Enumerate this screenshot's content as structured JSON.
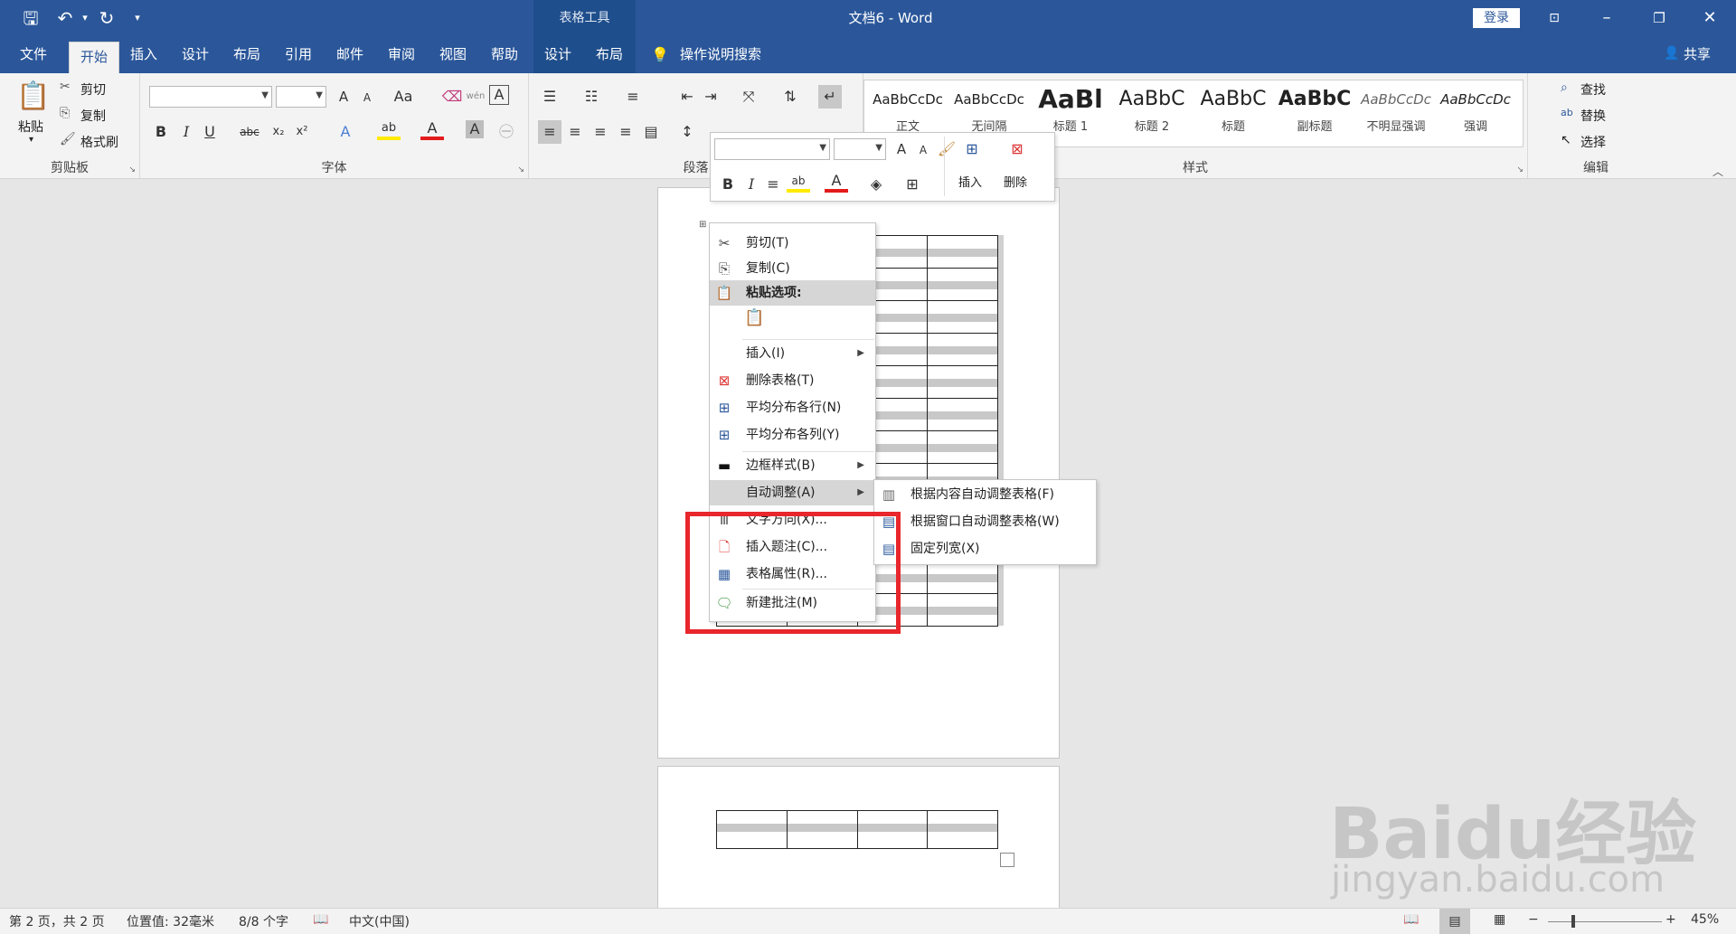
{
  "window": {
    "title": "文档6  -  Word",
    "context_title": "表格工具",
    "login": "登录",
    "share": "共享"
  },
  "tabs": [
    {
      "label": "文件"
    },
    {
      "label": "开始"
    },
    {
      "label": "插入"
    },
    {
      "label": "设计"
    },
    {
      "label": "布局"
    },
    {
      "label": "引用"
    },
    {
      "label": "邮件"
    },
    {
      "label": "审阅"
    },
    {
      "label": "视图"
    },
    {
      "label": "帮助"
    },
    {
      "label": "设计"
    },
    {
      "label": "布局"
    }
  ],
  "tell_me": "操作说明搜索",
  "ribbon": {
    "clipboard": {
      "label": "剪贴板",
      "paste": "粘贴",
      "cut": "剪切",
      "copy": "复制",
      "format_painter": "格式刷"
    },
    "font": {
      "label": "字体",
      "bold": "B",
      "italic": "I",
      "underline": "U",
      "strike": "abc",
      "sub": "x₂",
      "sup": "x²",
      "grow": "A",
      "shrink": "A",
      "case": "Aa",
      "font_color": "A",
      "char_shade": "A",
      "phonetic": "wén"
    },
    "paragraph": {
      "label": "段落"
    },
    "styles": {
      "label": "样式",
      "items": [
        {
          "preview": "AaBbCcDc",
          "name": "正文"
        },
        {
          "preview": "AaBbCcDc",
          "name": "无间隔"
        },
        {
          "preview": "AaBl",
          "name": "标题 1"
        },
        {
          "preview": "AaBbC",
          "name": "标题 2"
        },
        {
          "preview": "AaBbC",
          "name": "标题"
        },
        {
          "preview": "AaBbC",
          "name": "副标题"
        },
        {
          "preview": "AaBbCcDc",
          "name": "不明显强调"
        },
        {
          "preview": "AaBbCcDc",
          "name": "强调"
        }
      ]
    },
    "editing": {
      "label": "编辑",
      "find": "查找",
      "replace": "替换",
      "select": "选择"
    }
  },
  "mini_toolbar": {
    "bold": "B",
    "italic": "I",
    "insert": "插入",
    "delete": "删除"
  },
  "context_menu": {
    "items": [
      {
        "label": "剪切(T)",
        "icon": "scissors-icon"
      },
      {
        "label": "复制(C)",
        "icon": "copy-icon"
      },
      {
        "label": "粘贴选项:",
        "icon": "paste-icon"
      },
      {
        "label": "插入(I)",
        "icon": "",
        "submenu": true
      },
      {
        "label": "删除表格(T)",
        "icon": "delete-table-icon"
      },
      {
        "label": "平均分布各行(N)",
        "icon": "distribute-rows-icon"
      },
      {
        "label": "平均分布各列(Y)",
        "icon": "distribute-columns-icon"
      },
      {
        "label": "边框样式(B)",
        "icon": "border-style-icon",
        "submenu": true
      },
      {
        "label": "自动调整(A)",
        "icon": "",
        "submenu": true
      },
      {
        "label": "文字方向(X)...",
        "icon": "text-direction-icon"
      },
      {
        "label": "插入题注(C)...",
        "icon": "caption-icon"
      },
      {
        "label": "表格属性(R)...",
        "icon": "table-properties-icon"
      },
      {
        "label": "新建批注(M)",
        "icon": "new-comment-icon"
      }
    ],
    "submenu": [
      {
        "label": "根据内容自动调整表格(F)"
      },
      {
        "label": "根据窗口自动调整表格(W)"
      },
      {
        "label": "固定列宽(X)"
      }
    ]
  },
  "status": {
    "page": "第 2 页，共 2 页",
    "position": "位置值: 32毫米",
    "words": "8/8 个字",
    "language": "中文(中国)",
    "zoom": "45%"
  },
  "watermark": {
    "brand": "Baidu经验",
    "url": "jingyan.baidu.com"
  }
}
